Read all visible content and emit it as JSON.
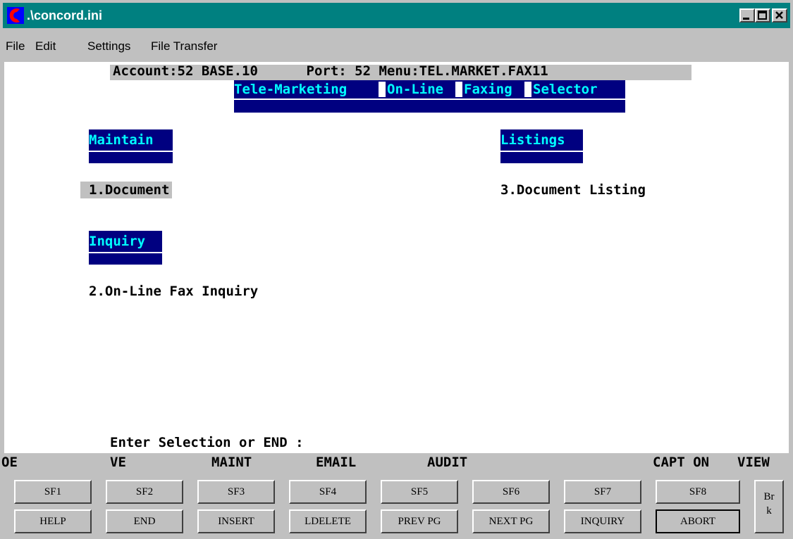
{
  "window": {
    "title": ".\\concord.ini",
    "accent": "#008080"
  },
  "menu": [
    "File",
    "Edit",
    "Settings",
    "File Transfer"
  ],
  "header": {
    "status_line": "Account:52 BASE.10      Port: 52 Menu:TEL.MARKET.FAX11"
  },
  "screen": {
    "title_words": [
      "Tele-Marketing",
      "On-Line",
      "Faxing",
      "Selector"
    ],
    "sections": {
      "maintain": "Maintain",
      "listings": "Listings",
      "inquiry": "Inquiry"
    },
    "options": {
      "opt1": "1.Document",
      "opt2": "2.On-Line Fax Inquiry",
      "opt3": "3.Document Listing"
    },
    "prompt": "Enter Selection or END :"
  },
  "fkey_labels": [
    "OE",
    "VE",
    "MAINT",
    "EMAIL",
    "AUDIT",
    "",
    "CAPT ON",
    "VIEW"
  ],
  "buttons": {
    "top": [
      "SF1",
      "SF2",
      "SF3",
      "SF4",
      "SF5",
      "SF6",
      "SF7",
      "SF8"
    ],
    "bottom": [
      "HELP",
      "END",
      "INSERT",
      "LDELETE",
      "PREV PG",
      "NEXT PG",
      "INQUIRY",
      "ABORT"
    ],
    "break_label": "Br\nk"
  },
  "colors": {
    "terminal_bg": "#ffffff",
    "block_bg": "#000080",
    "block_text": "#00ffff"
  }
}
